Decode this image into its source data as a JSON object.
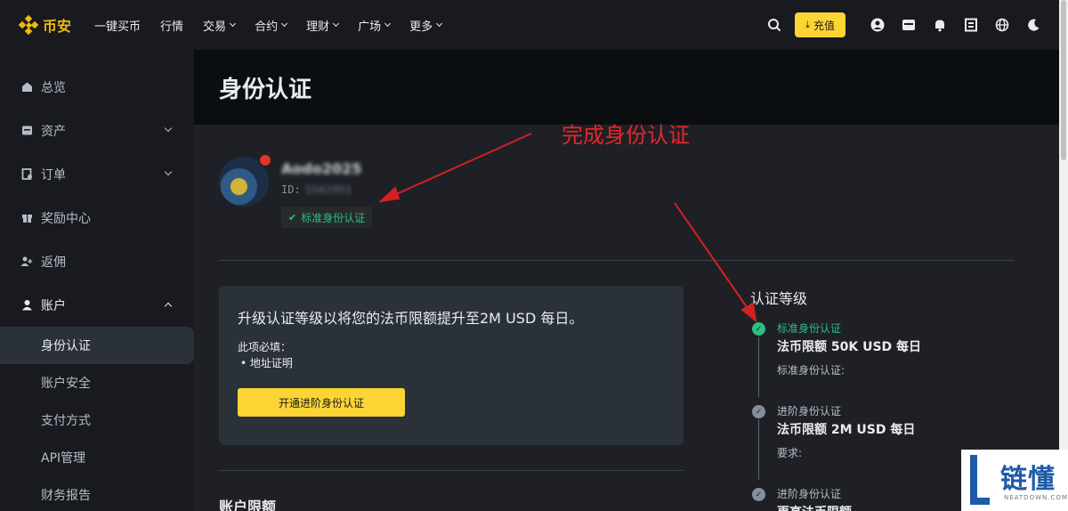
{
  "brand": {
    "name": "币安",
    "accent": "#f0b90b"
  },
  "nav": {
    "items": [
      {
        "label": "一键买币",
        "dropdown": false
      },
      {
        "label": "行情",
        "dropdown": false
      },
      {
        "label": "交易",
        "dropdown": true
      },
      {
        "label": "合约",
        "dropdown": true
      },
      {
        "label": "理财",
        "dropdown": true
      },
      {
        "label": "广场",
        "dropdown": true
      },
      {
        "label": "更多",
        "dropdown": true
      }
    ],
    "deposit_label": "充值",
    "icons": [
      "search-icon",
      "user-icon",
      "wallet-icon",
      "bell-icon",
      "download-qr-icon",
      "globe-icon",
      "moon-icon"
    ]
  },
  "sidebar": {
    "items": [
      {
        "label": "总览",
        "icon": "home-icon"
      },
      {
        "label": "资产",
        "icon": "wallet-icon"
      },
      {
        "label": "订单",
        "icon": "order-icon"
      },
      {
        "label": "奖励中心",
        "icon": "reward-icon"
      },
      {
        "label": "返佣",
        "icon": "referral-icon"
      },
      {
        "label": "账户",
        "icon": "account-icon"
      }
    ],
    "sub_items": [
      {
        "label": "身份认证",
        "selected": true
      },
      {
        "label": "账户安全",
        "selected": false
      },
      {
        "label": "支付方式",
        "selected": false
      },
      {
        "label": "API管理",
        "selected": false
      },
      {
        "label": "财务报告",
        "selected": false
      }
    ]
  },
  "page": {
    "title": "身份认证",
    "user": {
      "name": "Aodo2025",
      "id_label": "ID:",
      "id_value": "1042951",
      "status": "标准身份认证"
    }
  },
  "upgrade": {
    "title": "升级认证等级以将您的法币限额提升至2M USD 每日。",
    "req_label": "此项必填：",
    "req_item": "地址证明",
    "button": "开通进阶身份认证"
  },
  "limits": {
    "section_title": "账户限额"
  },
  "levels": {
    "title": "认证等级",
    "items": [
      {
        "label": "标准身份认证",
        "limit": "法币限额 50K USD 每日",
        "sub": "标准身份认证:",
        "done": true
      },
      {
        "label": "进阶身份认证",
        "limit": "法币限额 2M USD 每日",
        "sub": "要求:",
        "done": false
      },
      {
        "label": "进阶身份认证",
        "limit": "更高法币限额",
        "sub": "",
        "done": false
      }
    ]
  },
  "annotation": {
    "text": "完成身份认证",
    "color": "#e8262a"
  },
  "watermark": {
    "mark": "链懂",
    "sub": "NEATDOWN.COM"
  },
  "colors": {
    "success": "#2ebd85",
    "primary_button": "#fcd535"
  }
}
